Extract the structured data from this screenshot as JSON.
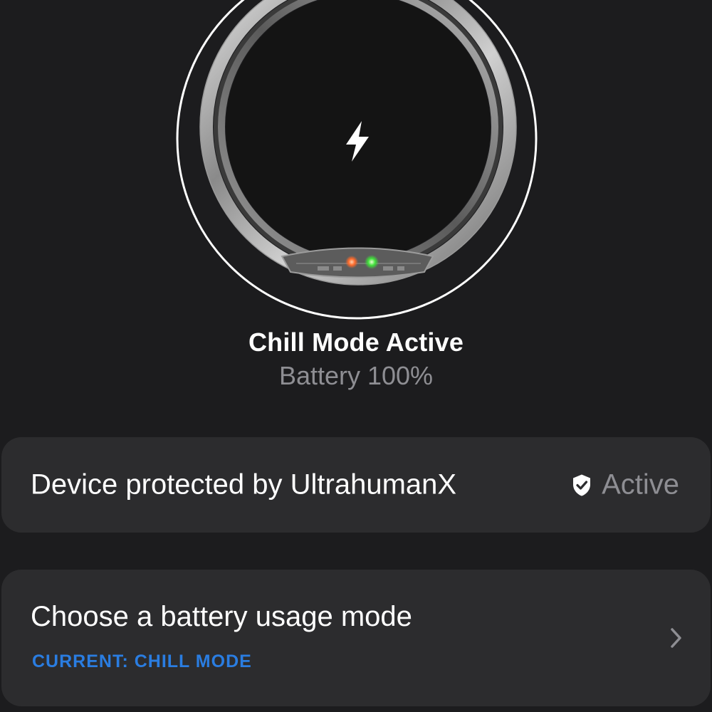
{
  "device": {
    "status_title": "Chill Mode Active",
    "battery_text": "Battery 100%",
    "battery_level": 100,
    "charging_icon": "lightning-bolt-icon"
  },
  "protection": {
    "label": "Device protected by UltrahumanX",
    "status": "Active",
    "status_icon": "shield-check-icon"
  },
  "battery_mode": {
    "label": "Choose a battery usage mode",
    "current": "CURRENT: CHILL MODE",
    "chevron_icon": "chevron-right-icon"
  },
  "colors": {
    "background": "#1c1c1e",
    "card": "#2c2c2e",
    "accent_blue": "#2a7de1",
    "secondary_text": "#8e8e93"
  }
}
